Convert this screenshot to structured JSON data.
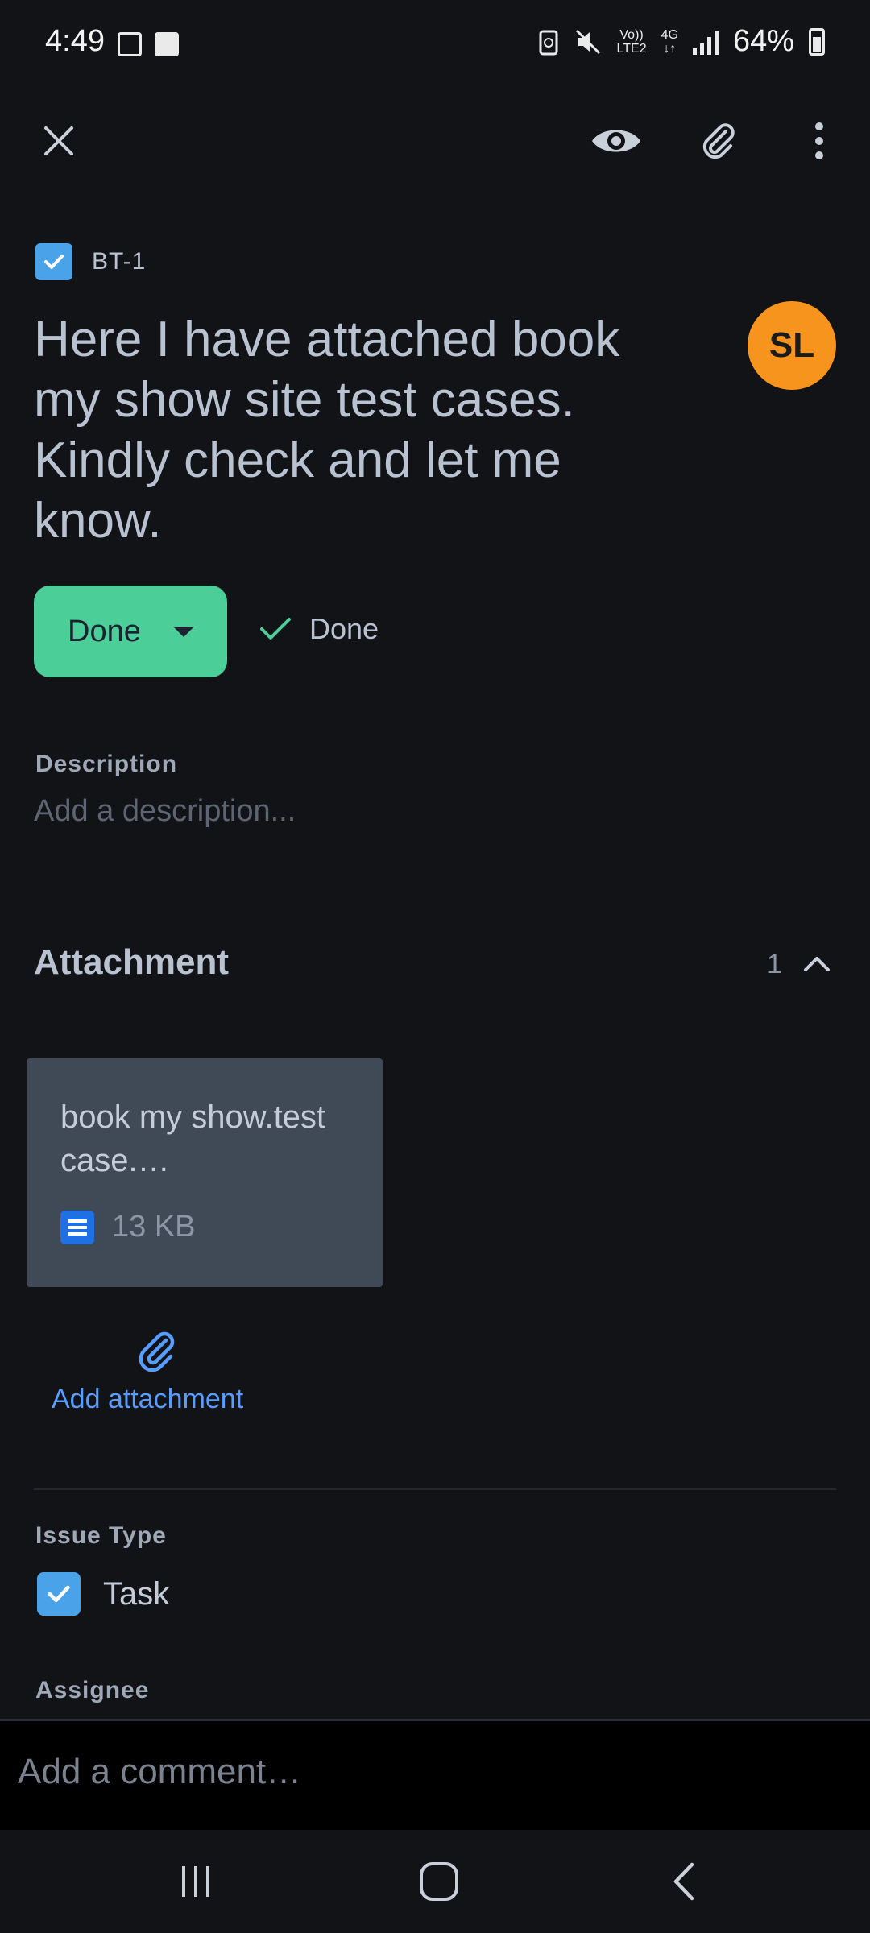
{
  "status_bar": {
    "time": "4:49",
    "network_line1": "Vo))",
    "network_line2": "LTE2",
    "network_gen": "4G",
    "battery": "64%"
  },
  "toolbar": {
    "close_icon": "close-icon",
    "watch_icon": "eye-icon",
    "attach_icon": "paperclip-icon",
    "more_icon": "more-vertical-icon"
  },
  "issue": {
    "key": "BT-1",
    "summary": "Here I have attached book my show site test cases. Kindly check and let me know.",
    "assignee_initials": "SL",
    "status": "Done",
    "resolution": "Done"
  },
  "description": {
    "label": "Description",
    "placeholder": "Add a description..."
  },
  "attachments": {
    "title": "Attachment",
    "count": "1",
    "items": [
      {
        "name": "book my show.test case.…",
        "size": "13 KB",
        "icon": "document-icon"
      }
    ],
    "add_label": "Add attachment"
  },
  "fields": {
    "issue_type_label": "Issue Type",
    "issue_type_value": "Task",
    "assignee_label": "Assignee"
  },
  "comment": {
    "placeholder": "Add a comment…"
  },
  "colors": {
    "background": "#121317",
    "status_done": "#4bce97",
    "avatar": "#f7941d",
    "link": "#579dff",
    "task_icon": "#4aa3e8"
  }
}
